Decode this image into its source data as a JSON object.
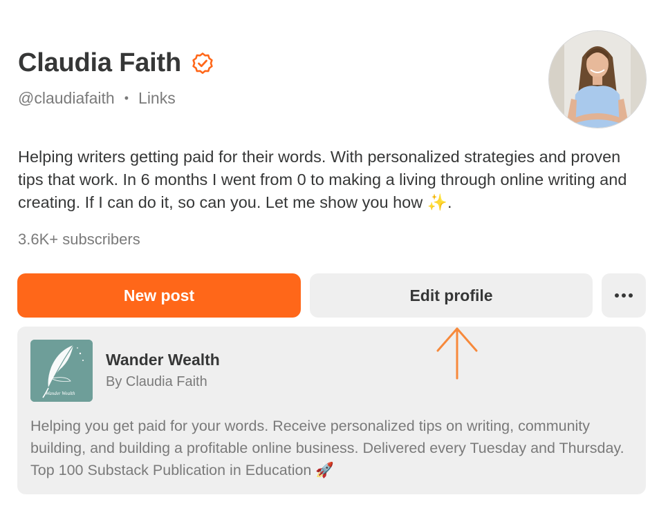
{
  "profile": {
    "name": "Claudia Faith",
    "handle": "@claudiafaith",
    "separator": "•",
    "links_label": "Links",
    "bio": "Helping writers getting paid for their words. With personalized strategies and proven tips that work. In 6 months I went from 0 to making a living through online writing and creating. If I can do it, so can you. Let me show you how ✨.",
    "subscribers": "3.6K+ subscribers",
    "verified_icon": "verified-check-icon"
  },
  "actions": {
    "new_post_label": "New post",
    "edit_profile_label": "Edit profile",
    "more_icon": "more-horizontal-icon"
  },
  "publication": {
    "title": "Wander Wealth",
    "byline": "By Claudia Faith",
    "logo_text": "Wander Wealth",
    "description": "Helping you get paid for your words. Receive personalized tips on writing, community building, and building a profitable online business. Delivered every Tuesday and Thursday. Top 100 Substack Publication in Education 🚀"
  },
  "annotation": {
    "arrow_icon": "arrow-up-icon"
  },
  "colors": {
    "accent": "#ff6719",
    "button_bg": "#efefef",
    "text": "#363737",
    "muted": "#7a7a7a",
    "pub_logo_bg": "#6e9e99"
  }
}
